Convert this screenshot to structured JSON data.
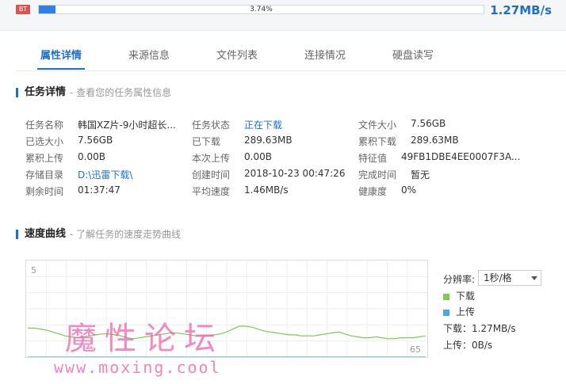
{
  "top": {
    "badge": "BT",
    "progress_text": "3.74%",
    "progress_fraction": 0.0374,
    "speed": "1.27MB/s"
  },
  "tabs": [
    {
      "label": "属性详情",
      "active": true
    },
    {
      "label": "来源信息",
      "active": false
    },
    {
      "label": "文件列表",
      "active": false
    },
    {
      "label": "连接情况",
      "active": false
    },
    {
      "label": "硬盘读写",
      "active": false
    }
  ],
  "task_section": {
    "title": "任务详情",
    "subtitle": "- 查看您的任务属性信息"
  },
  "task_info": {
    "col1": [
      {
        "k": "任务名称",
        "v": "韩国XZ片-9小时超长..."
      },
      {
        "k": "已选大小",
        "v": "7.56GB"
      },
      {
        "k": "累积上传",
        "v": "0.00B"
      },
      {
        "k": "存储目录",
        "v": "D:\\迅雷下载\\"
      },
      {
        "k": "剩余时间",
        "v": "01:37:47"
      }
    ],
    "col2": [
      {
        "k": "任务状态",
        "v": "正在下载"
      },
      {
        "k": "已下载",
        "v": "289.63MB"
      },
      {
        "k": "本次上传",
        "v": "0.00B"
      },
      {
        "k": "创建时间",
        "v": "2018-10-23 00:47:26"
      },
      {
        "k": "平均速度",
        "v": "1.46MB/s"
      }
    ],
    "col3": [
      {
        "k": "文件大小",
        "v": "7.56GB"
      },
      {
        "k": "累积下载",
        "v": "289.63MB"
      },
      {
        "k": "特征值",
        "v": "49FB1DBE4EE0007F3A..."
      },
      {
        "k": "完成时间",
        "v": "暂无"
      },
      {
        "k": "健康度",
        "v": "0%"
      }
    ]
  },
  "speed_section": {
    "title": "速度曲线",
    "subtitle": "- 了解任务的速度走势曲线"
  },
  "chart": {
    "y_top_label": "5",
    "x_right_label": "65",
    "resolution_label": "分辨率:",
    "resolution_value": "1秒/格",
    "legend_download": "下载",
    "legend_upload": "上传",
    "download_speed": "下载：1.27MB/s",
    "upload_speed": "上传：0B/s",
    "download_color": "#7ec857",
    "upload_color": "#4aa8e0"
  },
  "chart_data": {
    "type": "line",
    "x": [
      1,
      2,
      3,
      4,
      5,
      6,
      7,
      8,
      9,
      10,
      11,
      12,
      13,
      14,
      15,
      16,
      17,
      18,
      19,
      20,
      21,
      22,
      23,
      24,
      25,
      26,
      27,
      28,
      29,
      30,
      31,
      32,
      33,
      34,
      35,
      36,
      37,
      38,
      39,
      40,
      41,
      42,
      43,
      44,
      45,
      46,
      47,
      48,
      49,
      50,
      51,
      52,
      53,
      54,
      55,
      56,
      57,
      58,
      59,
      60,
      61,
      62,
      63,
      64,
      65
    ],
    "series": [
      {
        "name": "下载",
        "values": [
          1.5,
          1.5,
          1.45,
          1.4,
          1.3,
          1.2,
          1.1,
          1.05,
          1.0,
          1.05,
          1.1,
          1.15,
          1.2,
          1.2,
          1.15,
          1.1,
          1.0,
          0.95,
          1.0,
          1.05,
          1.1,
          1.15,
          1.2,
          1.25,
          1.25,
          1.2,
          1.15,
          1.1,
          1.1,
          1.1,
          1.15,
          1.2,
          1.3,
          1.45,
          1.6,
          1.6,
          1.55,
          1.45,
          1.35,
          1.3,
          1.25,
          1.2,
          1.15,
          1.15,
          1.1,
          1.1,
          1.1,
          1.15,
          1.2,
          1.25,
          1.3,
          1.2,
          1.1,
          1.05,
          1.0,
          1.0,
          1.05,
          1.0,
          0.95,
          0.95,
          1.0,
          1.0,
          1.0,
          1.05,
          1.1
        ]
      },
      {
        "name": "上传",
        "values": [
          0,
          0,
          0,
          0,
          0,
          0,
          0,
          0,
          0,
          0,
          0,
          0,
          0,
          0,
          0,
          0,
          0,
          0,
          0,
          0,
          0,
          0,
          0,
          0,
          0,
          0,
          0,
          0,
          0,
          0,
          0,
          0,
          0,
          0,
          0,
          0,
          0,
          0,
          0,
          0,
          0,
          0,
          0,
          0,
          0,
          0,
          0,
          0,
          0,
          0,
          0,
          0,
          0,
          0,
          0,
          0,
          0,
          0,
          0,
          0,
          0,
          0,
          0,
          0,
          0
        ]
      }
    ],
    "ylim": [
      0,
      5
    ],
    "grid": true
  },
  "watermark": {
    "title": "魔性论坛",
    "url": "www.moxing.cool"
  }
}
